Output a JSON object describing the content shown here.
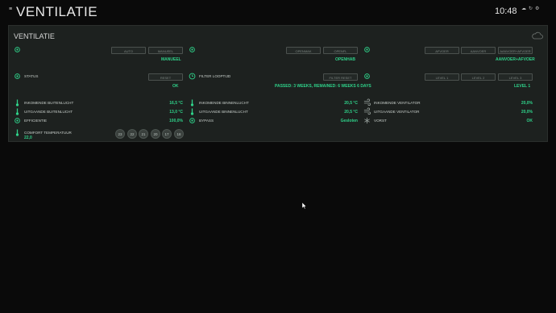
{
  "header": {
    "menu_glyph": "≡",
    "title": "VENTILATIE",
    "time": "10:48"
  },
  "panel": {
    "title": "VENTILATIE"
  },
  "modes": {
    "group1": {
      "buttons": [
        "AUTO",
        "MANUEEL"
      ],
      "value": "MANUEEL"
    },
    "group2": {
      "buttons": [
        "OPENMAK",
        "OPENFL"
      ],
      "value": "OPENHAB"
    },
    "group3": {
      "buttons": [
        "AFVOER",
        "AANVOER",
        "AANVOER+AFVOER"
      ],
      "value": "AANVOER+AFVOER"
    }
  },
  "status": {
    "label": "STATUS",
    "button": "RESET",
    "value": "OK"
  },
  "filter": {
    "label": "FILTER LOOPTIJD",
    "button": "FILTER RESET",
    "value": "PASSED: 3 WEEKS, REMAINED: 6 WEEKS 6 DAYS"
  },
  "levels": {
    "buttons": [
      "LEVEL 1",
      "LEVEL 2",
      "LEVEL 3"
    ],
    "value": "LEVEL 1"
  },
  "sensors": {
    "col1": [
      {
        "label": "INKOMENDE BUITENLUCHT",
        "value": "16,5 °C",
        "icon": "thermometer-icon"
      },
      {
        "label": "UITGAANDE BUITENLUCHT",
        "value": "13,0 °C",
        "icon": "thermometer-icon"
      },
      {
        "label": "EFFICIENTIE",
        "value": "100,0%",
        "icon": "gear-icon"
      }
    ],
    "col2": [
      {
        "label": "INKOMENDE BINNENLUCHT",
        "value": "20,5 °C",
        "icon": "thermometer-icon"
      },
      {
        "label": "UITGAANDE BINNENLUCHT",
        "value": "20,5 °C",
        "icon": "thermometer-icon"
      },
      {
        "label": "BYPASS",
        "value": "Gesloten",
        "icon": "gear-icon"
      }
    ],
    "col3": [
      {
        "label": "INKOMENDE VENTILATOR",
        "value": "20,0%",
        "icon": "wind-icon"
      },
      {
        "label": "UITGAANDE VENTILATOR",
        "value": "20,0%",
        "icon": "wind-icon"
      },
      {
        "label": "VORST",
        "value": "OK",
        "icon": "snowflake-icon"
      }
    ]
  },
  "comfort": {
    "label": "COMFORT TEMPERATUUR",
    "value": "22,0",
    "options": [
      "23",
      "22",
      "21",
      "20",
      "17",
      "18"
    ]
  },
  "colors": {
    "accent": "#2fd28a",
    "panel": "#1d211f",
    "background": "#0a0a0a"
  }
}
